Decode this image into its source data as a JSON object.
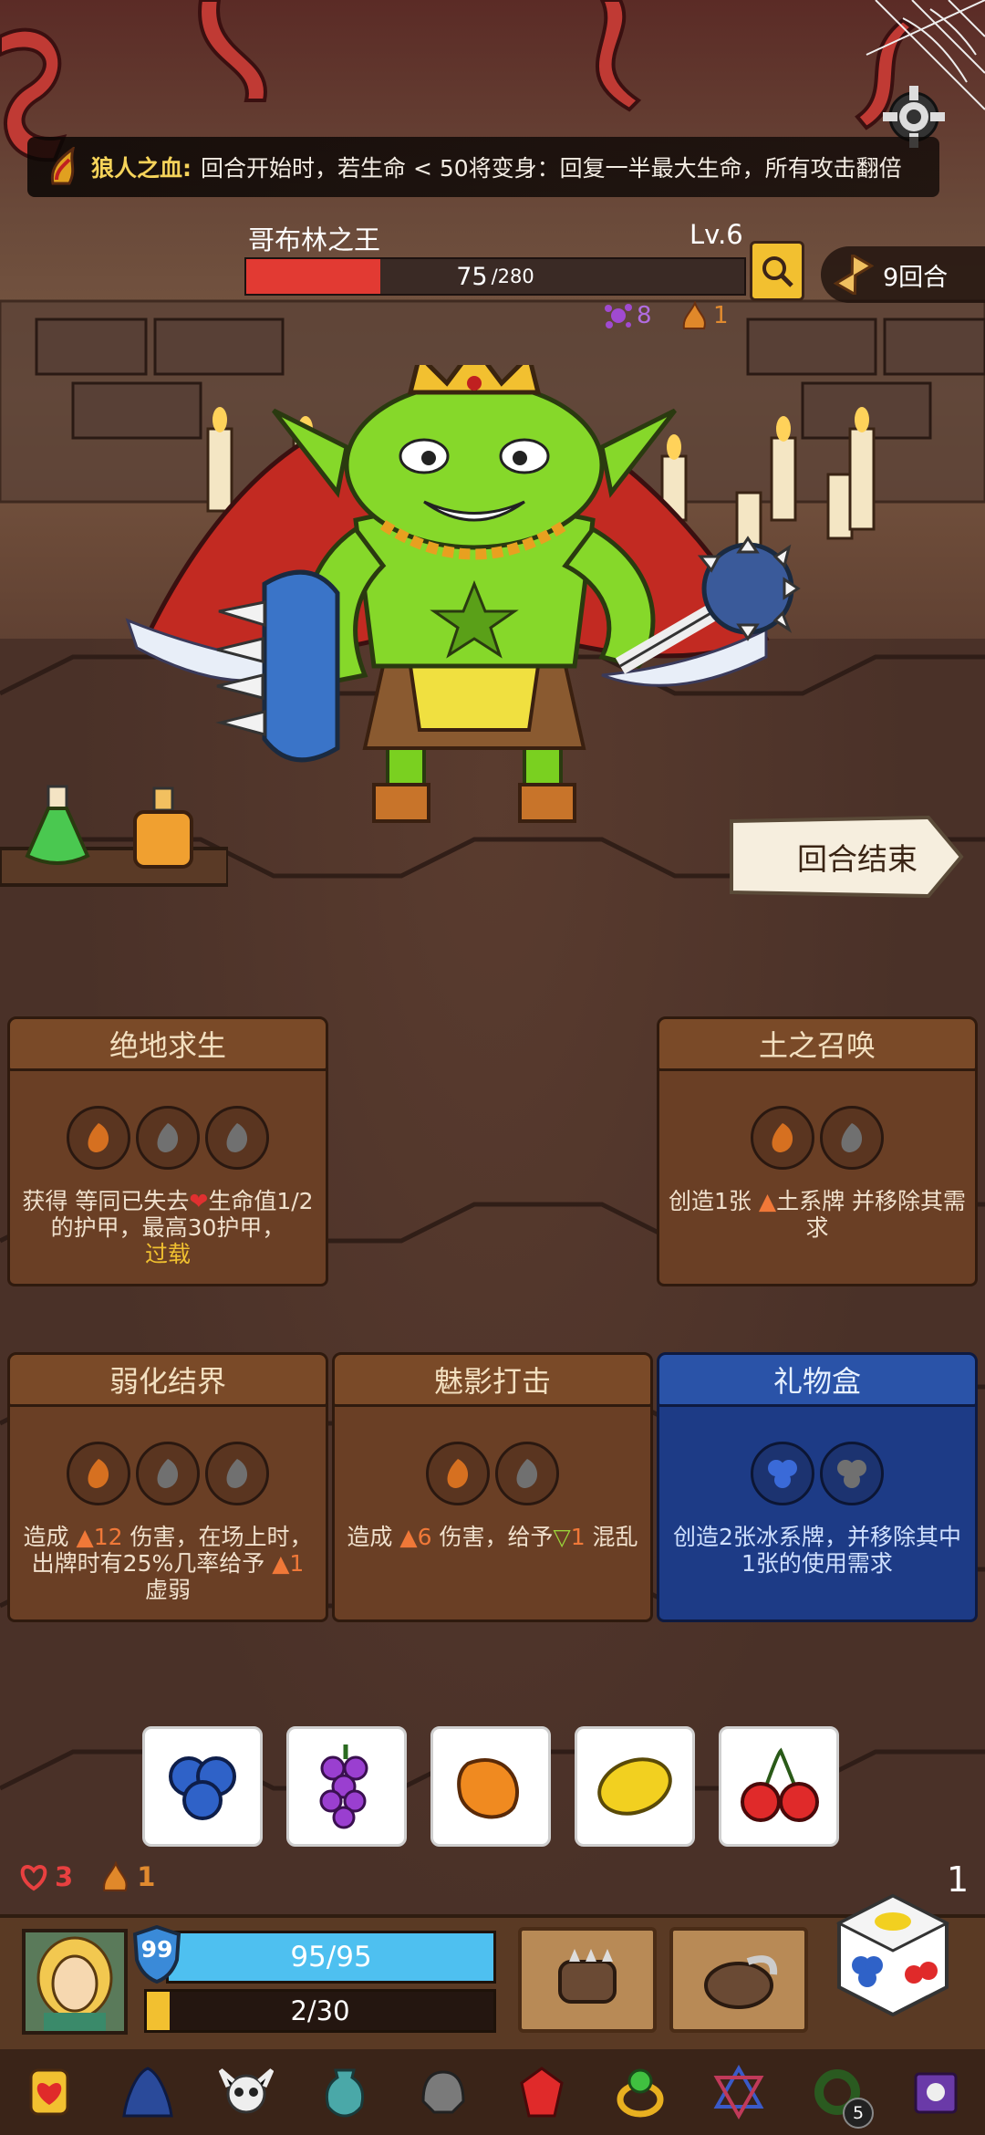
{
  "banner": {
    "buff_icon": "werewolf-blood-icon",
    "name": "狼人之血:",
    "description": "回合开始时，若生命 < 50将变身：回复一半最大生命，所有攻击翻倍"
  },
  "enemy": {
    "name": "哥布林之王",
    "level": "Lv.6",
    "hp_current": "75",
    "hp_max": "/280",
    "hp_fraction": 0.27,
    "stat_1_value": "8",
    "stat_1_icon": "purple-splat-icon",
    "stat_2_value": "1",
    "stat_2_icon": "orange-flame-icon"
  },
  "round": {
    "label": "9回合"
  },
  "end_turn": {
    "label": "回合结束"
  },
  "cards": [
    {
      "title": "绝地求生",
      "slots": [
        "orange",
        "gray",
        "gray"
      ],
      "desc_a": "获得 等同已失去",
      "desc_b": "生命值1/2 的护甲，最高30护甲，",
      "desc_c": "过载",
      "type": "normal"
    },
    {
      "title": "土之召唤",
      "slots": [
        "orange",
        "gray"
      ],
      "desc_a": "创造1张 ",
      "desc_b": "土系牌 并移除其需求",
      "type": "normal"
    },
    {
      "title": "弱化结界",
      "slots": [
        "orange",
        "gray",
        "gray"
      ],
      "desc_a": "造成 ",
      "desc_dmg": "12",
      "desc_b": " 伤害，在场上时，出牌时有25%几率给予 ",
      "desc_weak": "1",
      "desc_c": " 虚弱",
      "type": "normal"
    },
    {
      "title": "魅影打击",
      "slots": [
        "orange",
        "gray"
      ],
      "desc_a": "造成 ",
      "desc_dmg": "6",
      "desc_b": " 伤害，给予",
      "desc_conf": "1",
      "desc_c": " 混乱",
      "type": "normal"
    },
    {
      "title": "礼物盒",
      "slots": [
        "blue",
        "gray"
      ],
      "desc_a": "创造2张冰系牌，并移除其中1张的使用需求",
      "type": "ice"
    }
  ],
  "dice": [
    {
      "icon": "blueberry-icon",
      "color": "#2f62c8"
    },
    {
      "icon": "grape-icon",
      "color": "#9a3fd0"
    },
    {
      "icon": "orange-icon",
      "color": "#f08a20"
    },
    {
      "icon": "lemon-icon",
      "color": "#f2d020"
    },
    {
      "icon": "cherry-icon",
      "color": "#e02a2a"
    }
  ],
  "status": {
    "heart_value": "3",
    "flame_value": "1",
    "page": "1"
  },
  "player": {
    "shield": "99",
    "hp": "95/95",
    "exp": "2/30",
    "exp_fraction": 0.067
  },
  "relics": [
    {
      "icon": "heart-gem-icon"
    },
    {
      "icon": "blue-cloak-icon"
    },
    {
      "icon": "viking-skull-icon"
    },
    {
      "icon": "teal-vase-icon"
    },
    {
      "icon": "steel-helmet-icon"
    },
    {
      "icon": "red-crystal-icon"
    },
    {
      "icon": "emerald-ring-icon"
    },
    {
      "icon": "hexagram-icon"
    },
    {
      "icon": "wreath-icon",
      "count": "5"
    },
    {
      "icon": "purple-skull-book-icon"
    }
  ],
  "colors": {
    "hp_red": "#e23a33",
    "mana_blue": "#4ec0f0",
    "exp_gold": "#f2c030",
    "ice_card": "#1d3b86"
  }
}
